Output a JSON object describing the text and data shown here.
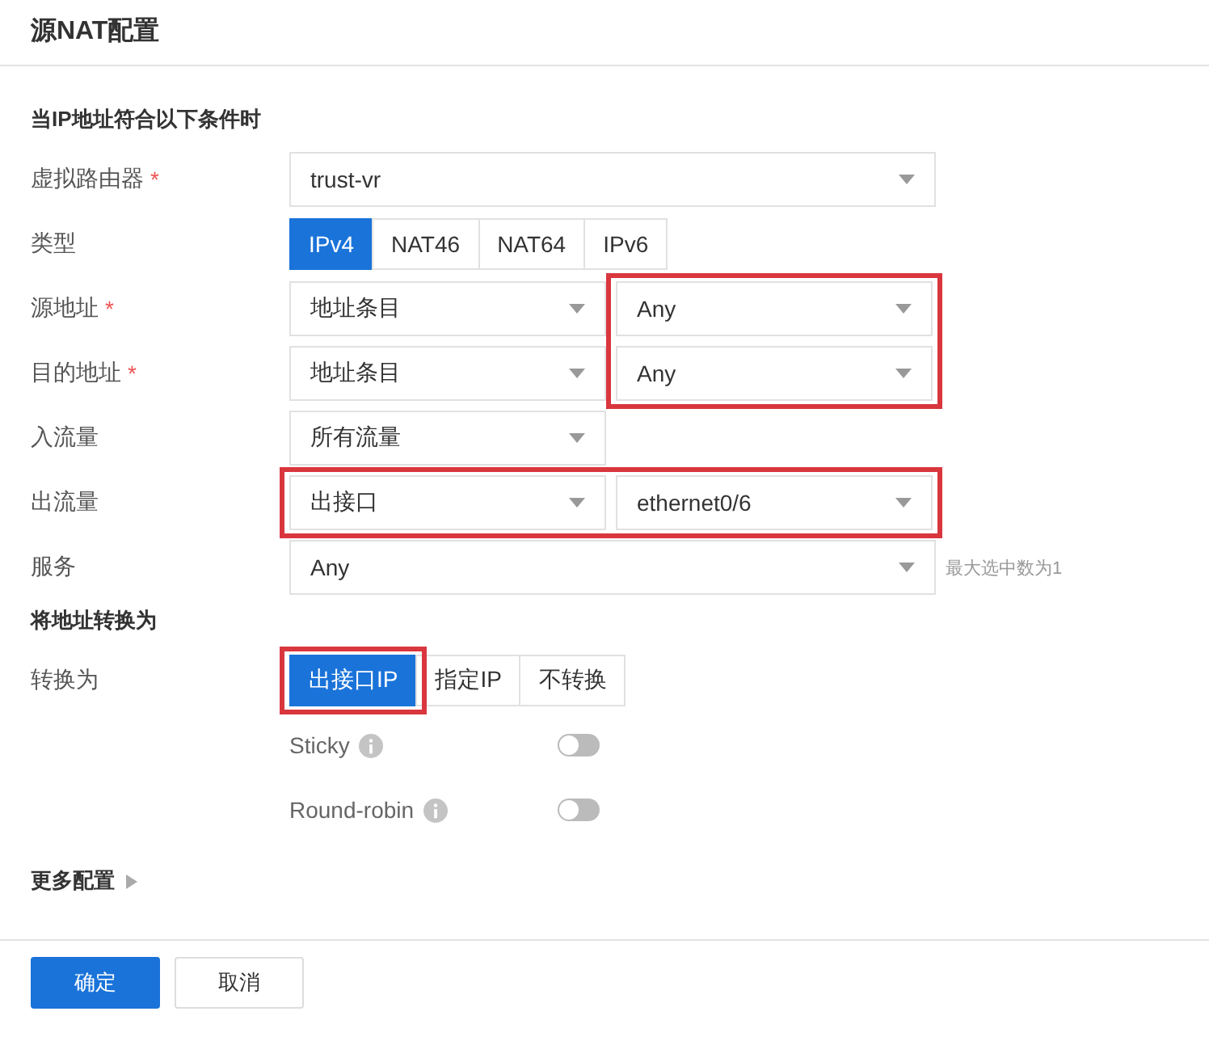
{
  "title": "源NAT配置",
  "sections": [
    {
      "heading": "当IP地址符合以下条件时",
      "rows": [
        {
          "label": "虚拟路由器",
          "required_mark": "*",
          "controls": [
            {
              "kind": "select-wide",
              "value": "trust-vr",
              "highlighted": false
            }
          ]
        },
        {
          "label": "类型",
          "controls": [
            {
              "kind": "segmented",
              "options": [
                {
                  "label": "IPv4",
                  "selected": true,
                  "highlighted": false
                },
                {
                  "label": "NAT46",
                  "selected": false,
                  "highlighted": false
                },
                {
                  "label": "NAT64",
                  "selected": false,
                  "highlighted": false
                },
                {
                  "label": "IPv6",
                  "selected": false,
                  "highlighted": false
                }
              ]
            }
          ]
        },
        {
          "label": "源地址",
          "required_mark": "*",
          "controls": [
            {
              "kind": "select",
              "value": "地址条目",
              "highlighted": false
            },
            {
              "kind": "select",
              "value": "Any",
              "highlighted": true
            }
          ]
        },
        {
          "label": "目的地址",
          "required_mark": "*",
          "controls": [
            {
              "kind": "select",
              "value": "地址条目",
              "highlighted": false
            },
            {
              "kind": "select",
              "value": "Any",
              "highlighted": true
            }
          ]
        },
        {
          "label": "入流量",
          "controls": [
            {
              "kind": "select",
              "value": "所有流量",
              "highlighted": false
            }
          ]
        },
        {
          "label": "出流量",
          "controls": [
            {
              "kind": "select",
              "value": "出接口",
              "highlighted": true
            },
            {
              "kind": "select",
              "value": "ethernet0/6",
              "highlighted": true
            }
          ]
        },
        {
          "label": "服务",
          "controls": [
            {
              "kind": "select-wide",
              "value": "Any",
              "highlighted": false
            },
            {
              "kind": "hint",
              "text": "最大选中数为1"
            }
          ]
        }
      ]
    },
    {
      "heading": "将地址转换为",
      "rows": [
        {
          "label": "转换为",
          "controls": [
            {
              "kind": "segmented",
              "options": [
                {
                  "label": "出接口IP",
                  "selected": true,
                  "highlighted": true
                },
                {
                  "label": "指定IP",
                  "selected": false,
                  "highlighted": false
                },
                {
                  "label": "不转换",
                  "selected": false,
                  "highlighted": false
                }
              ]
            }
          ]
        },
        {
          "controls": [
            {
              "kind": "toggle",
              "text": "Sticky",
              "on": false
            }
          ]
        },
        {
          "controls": [
            {
              "kind": "toggle",
              "text": "Round-robin",
              "on": false
            }
          ]
        }
      ]
    }
  ],
  "more": {
    "label": "更多配置",
    "expanded": false
  },
  "buttons": [
    {
      "label": "确定",
      "primary": true
    },
    {
      "label": "取消",
      "primary": false
    }
  ]
}
